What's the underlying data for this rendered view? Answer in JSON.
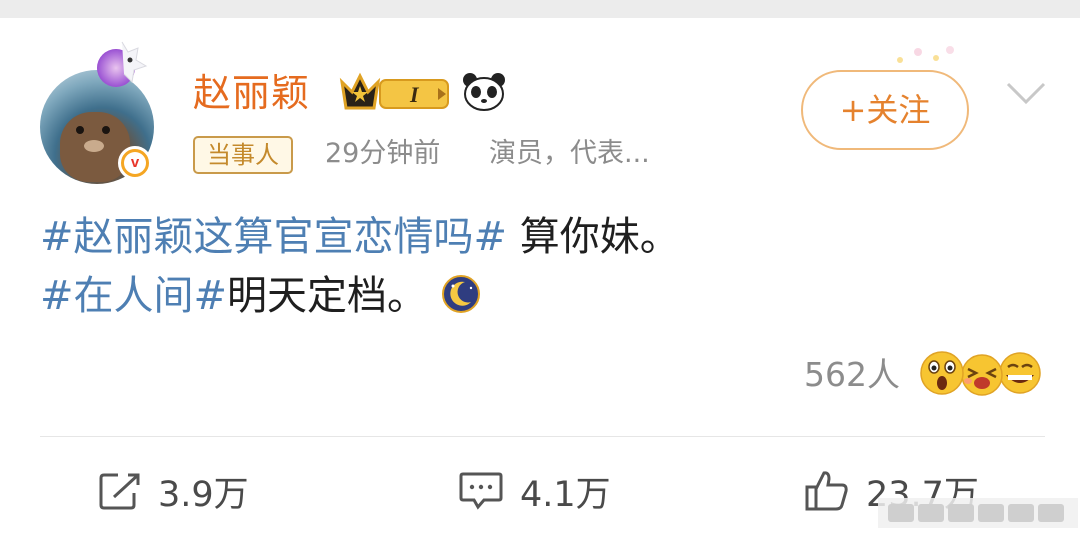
{
  "post": {
    "author": {
      "name": "赵丽颖",
      "level_badge": "I",
      "verified": true
    },
    "tag": "当事人",
    "time": "29分钟前",
    "role": "演员，代表...",
    "follow_label": "+关注",
    "content": {
      "line1_topic": "#赵丽颖这算官宣恋情吗#",
      "line1_text": " 算你妹。",
      "line2_topic": "#在人间#",
      "line2_text": "明天定档。"
    },
    "reactions": {
      "count": "562人"
    },
    "actions": {
      "share": "3.9万",
      "comment": "4.1万",
      "like": "23.7万"
    }
  },
  "colors": {
    "username": "#e56b1f",
    "topic_link": "#4e7fb3",
    "follow_border": "#f0b97a",
    "follow_text": "#e5822e",
    "meta_gray": "#8c8c8c"
  },
  "icons": [
    "crown-badge-icon",
    "panda-icon",
    "verified-v-icon",
    "chevron-down-icon",
    "moon-emoji-icon",
    "surprised-emoji-icon",
    "laugh-emoji-icon",
    "grin-emoji-icon",
    "share-icon",
    "comment-icon",
    "thumbs-up-icon"
  ]
}
